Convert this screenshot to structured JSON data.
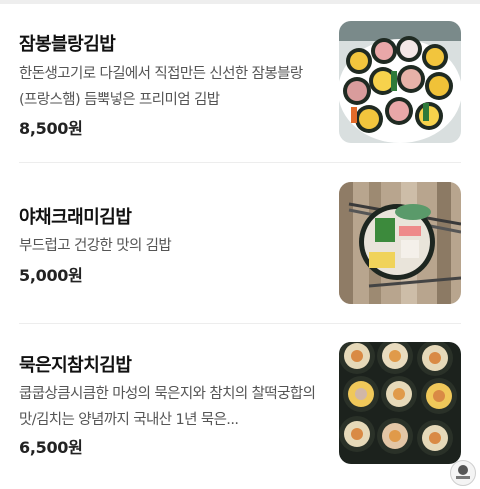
{
  "menu": {
    "items": [
      {
        "name": "잠봉블랑김밥",
        "description": "한돈생고기로 다길에서 직접만든 신선한 잠봉블랑(프랑스햄) 듬뿍넣은 프리미엄 김밥",
        "price": "8,500원",
        "image_icon": "kimbap-platter-image"
      },
      {
        "name": "야채크래미김밥",
        "description": "부드럽고 건강한 맛의 김밥",
        "price": "5,000원",
        "image_icon": "kimbap-chopsticks-image"
      },
      {
        "name": "묵은지참치김밥",
        "description": "쿱쿱상큼시큼한 마성의 묵은지와 참치의 찰떡궁합의 맛/김치는 양념까지 국내산 1년 묵은...",
        "price": "6,500원",
        "image_icon": "kimbap-rows-image"
      }
    ]
  },
  "colors": {
    "text_primary": "#111111",
    "text_secondary": "#555555",
    "divider": "#ededed"
  }
}
